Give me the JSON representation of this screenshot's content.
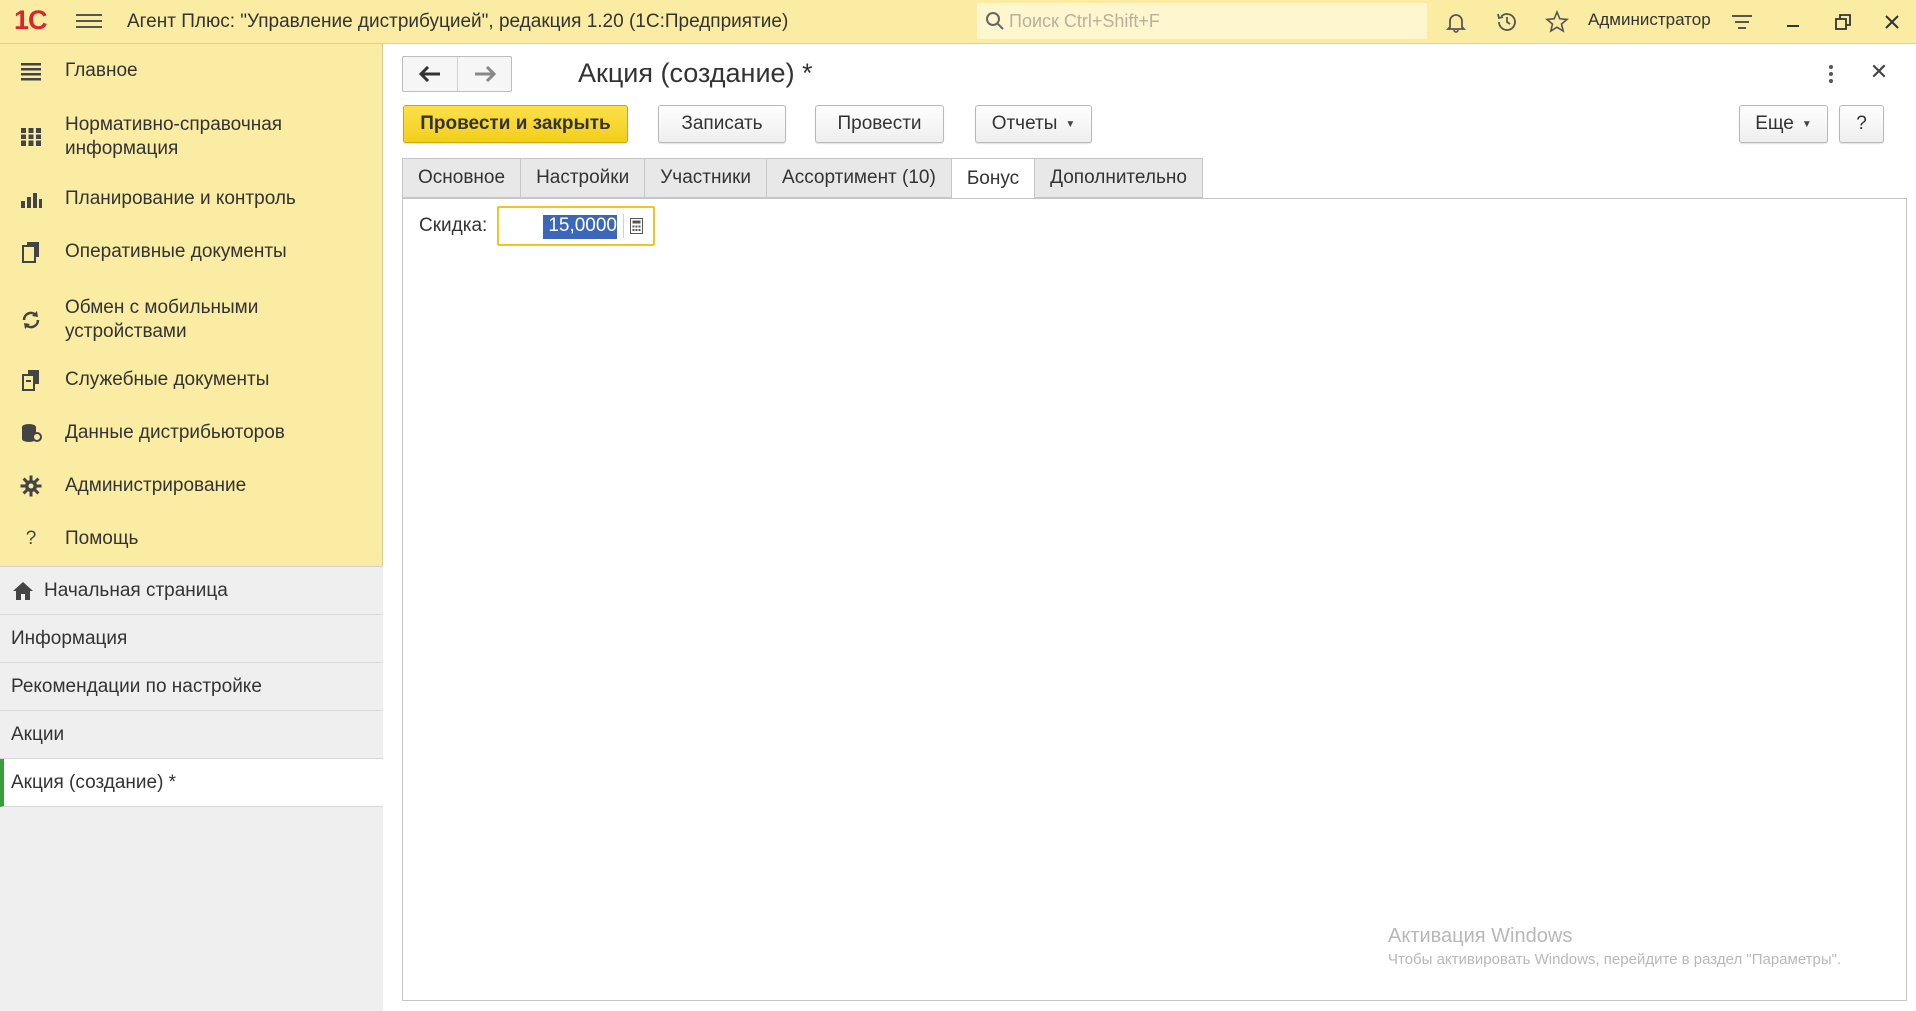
{
  "app": {
    "logo_text": "1С",
    "title": "Агент Плюс: \"Управление дистрибуцией\", редакция 1.20  (1С:Предприятие)",
    "search_placeholder": "Поиск Ctrl+Shift+F",
    "user": "Администратор"
  },
  "sidebar": {
    "sections": [
      {
        "label": "Главное",
        "icon": "menu-lines-icon"
      },
      {
        "label": "Нормативно-справочная информация",
        "icon": "grid-icon"
      },
      {
        "label": "Планирование и контроль",
        "icon": "bar-chart-icon"
      },
      {
        "label": "Оперативные документы",
        "icon": "documents-icon"
      },
      {
        "label": "Обмен с мобильными устройствами",
        "icon": "sync-icon"
      },
      {
        "label": "Служебные документы",
        "icon": "service-documents-icon"
      },
      {
        "label": "Данные дистрибьюторов",
        "icon": "database-icon"
      },
      {
        "label": "Администрирование",
        "icon": "gear-icon"
      },
      {
        "label": "Помощь",
        "icon": "question-icon"
      }
    ],
    "open_windows": [
      {
        "label": "Начальная страница",
        "icon": "home-icon"
      },
      {
        "label": "Информация"
      },
      {
        "label": "Рекомендации по настройке"
      },
      {
        "label": "Акции"
      },
      {
        "label": "Акция (создание) *",
        "active": true
      }
    ]
  },
  "form": {
    "title": "Акция (создание) *",
    "buttons": {
      "post_close": "Провести и закрыть",
      "save": "Записать",
      "post": "Провести",
      "reports": "Отчеты",
      "more": "Еще",
      "help": "?"
    },
    "tabs": [
      "Основное",
      "Настройки",
      "Участники",
      "Ассортимент (10)",
      "Бонус",
      "Дополнительно"
    ],
    "active_tab": "Бонус",
    "discount_label": "Скидка:",
    "discount_value": "15,0000"
  },
  "watermark": {
    "line1": "Активация Windows",
    "line2": "Чтобы активировать Windows, перейдите в раздел \"Параметры\"."
  },
  "colors": {
    "accent_yellow": "#fbeca3",
    "primary_button": "#f3cf1a",
    "active_marker": "#3a9e3a",
    "selection": "#3c66b8"
  }
}
